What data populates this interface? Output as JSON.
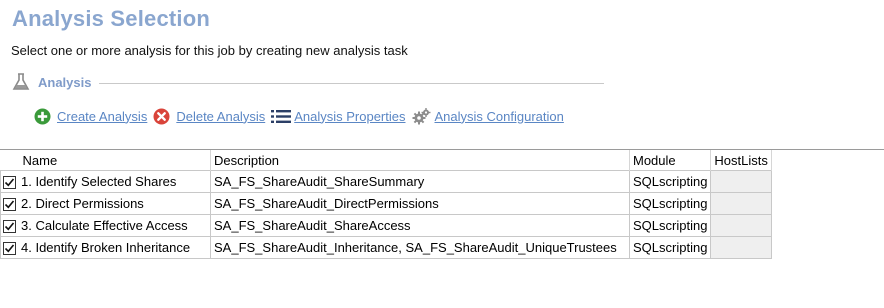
{
  "page": {
    "title": "Analysis Selection",
    "subtitle": "Select one or more analysis for this job by creating new analysis task"
  },
  "section": {
    "label": "Analysis",
    "icon": "flask-icon"
  },
  "toolbar": {
    "create_label": "Create Analysis",
    "delete_label": "Delete Analysis",
    "properties_label": "Analysis Properties",
    "configuration_label": "Analysis Configuration"
  },
  "table": {
    "columns": {
      "name": "Name",
      "description": "Description",
      "module": "Module",
      "hostlists": "HostLists"
    },
    "rows": [
      {
        "checked": true,
        "name": "1. Identify Selected Shares",
        "description": "SA_FS_ShareAudit_ShareSummary",
        "module": "SQLscripting",
        "hostlists": ""
      },
      {
        "checked": true,
        "name": "2. Direct Permissions",
        "description": "SA_FS_ShareAudit_DirectPermissions",
        "module": "SQLscripting",
        "hostlists": ""
      },
      {
        "checked": true,
        "name": "3. Calculate Effective Access",
        "description": "SA_FS_ShareAudit_ShareAccess",
        "module": "SQLscripting",
        "hostlists": ""
      },
      {
        "checked": true,
        "name": "4. Identify Broken Inheritance",
        "description": "SA_FS_ShareAudit_Inheritance, SA_FS_ShareAudit_UniqueTrustees",
        "module": "SQLscripting",
        "hostlists": ""
      }
    ]
  },
  "colors": {
    "title": "#8aa6cf",
    "link": "#5a86c4",
    "create_icon": "#3a9a3a",
    "delete_icon": "#d9443a"
  }
}
